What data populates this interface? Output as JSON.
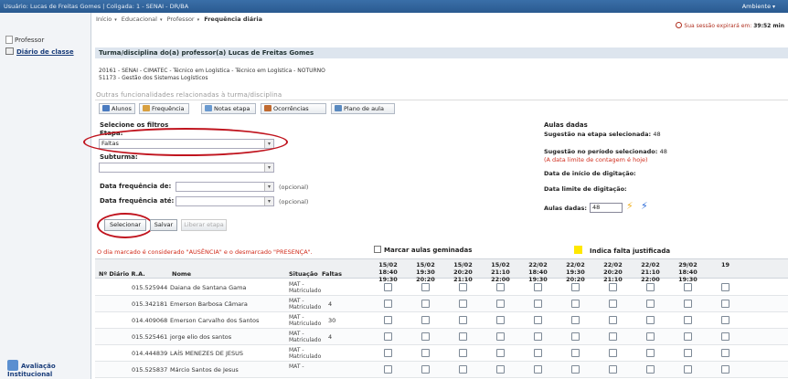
{
  "topbar": {
    "user": "Usuário: Lucas de Freitas Gomes  |  Coligada: 1 - SENAI - DR/BA",
    "ambiente": "Ambiente"
  },
  "breadcrumb": {
    "inicio": "Início",
    "educacional": "Educacional",
    "professor": "Professor",
    "current": "Frequência diária"
  },
  "session": {
    "text": "Sua sessão expirará em:",
    "time": "39:52 min"
  },
  "left_nav": {
    "professor": "Professor",
    "diario": "Diário de classe",
    "avaliacao": "Avaliação Institucional"
  },
  "panel": {
    "title": "Turma/disciplina do(a) professor(a) Lucas de Freitas Gomes",
    "turma": "20161 - SENAI - CIMATEC - Técnico em Logística - Técnico em Logística - NOTURNO",
    "disciplina": "51173 - Gestão dos Sistemas Logísticos",
    "outras": "Outras funcionalidades relacionadas à turma/disciplina"
  },
  "tabs": [
    "Alunos",
    "Frequência",
    "Notas etapa",
    "Ocorrências",
    "Plano de aula"
  ],
  "filters": {
    "title": "Selecione os filtros",
    "etapa_label": "Etapa:",
    "etapa_value": "Faltas",
    "subturma_label": "Subturma:",
    "subturma_value": "",
    "freq_de_label": "Data frequência de:",
    "freq_ate_label": "Data frequência até:",
    "opcional": "(opcional)"
  },
  "buttons": {
    "selecionar": "Selecionar",
    "salvar": "Salvar",
    "liberar": "Liberar etapa"
  },
  "aulas": {
    "title": "Aulas dadas",
    "sug_etapa_label": "Sugestão na etapa selecionada:",
    "sug_etapa_value": "48",
    "sug_periodo_label": "Sugestão no período selecionado:",
    "sug_periodo_value": "48",
    "limite_note": "(A data limite de contagem é hoje)",
    "inicio_label": "Data de início de digitação:",
    "limite_label": "Data limite de digitação:",
    "aulas_label": "Aulas dadas:",
    "aulas_value": "48"
  },
  "legend": {
    "note": "O dia marcado é considerado \"AUSÊNCIA\" e o desmarcado \"PRESENÇA\".",
    "geminadas": "Marcar aulas geminadas",
    "justificada": "Indica falta justificada",
    "justificada_color": "#ffe800"
  },
  "table": {
    "headers": {
      "diario": "Nº Diário R.A.",
      "nome": "Nome",
      "situacao": "Situação",
      "faltas": "Faltas"
    },
    "dates": [
      {
        "d": "15/02",
        "t": "18:40 19:30"
      },
      {
        "d": "15/02",
        "t": "19:30 20:20"
      },
      {
        "d": "15/02",
        "t": "20:20 21:10"
      },
      {
        "d": "15/02",
        "t": "21:10 22:00"
      },
      {
        "d": "22/02",
        "t": "18:40 19:30"
      },
      {
        "d": "22/02",
        "t": "19:30 20:20"
      },
      {
        "d": "22/02",
        "t": "20:20 21:10"
      },
      {
        "d": "22/02",
        "t": "21:10 22:00"
      },
      {
        "d": "29/02",
        "t": "18:40 19:30"
      },
      {
        "d": "",
        "t": "19"
      }
    ],
    "rows": [
      {
        "ra": "015.525944",
        "nome": "Daiana de Santana Gama",
        "sit1": "MAT -",
        "sit2": "Matriculado",
        "faltas": ""
      },
      {
        "ra": "015.342181",
        "nome": "Emerson Barbosa Câmara",
        "sit1": "MAT -",
        "sit2": "Matriculado",
        "faltas": "4"
      },
      {
        "ra": "014.409068",
        "nome": "Emerson Carvalho dos Santos",
        "sit1": "MAT -",
        "sit2": "Matriculado",
        "faltas": "30"
      },
      {
        "ra": "015.525461",
        "nome": "jorge elio dos santos",
        "sit1": "MAT -",
        "sit2": "Matriculado",
        "faltas": "4"
      },
      {
        "ra": "014.444839",
        "nome": "LAÍS MENEZES DE JESUS",
        "sit1": "MAT -",
        "sit2": "Matriculado",
        "faltas": ""
      },
      {
        "ra": "015.525837",
        "nome": "Márcio Santos de Jesus",
        "sit1": "MAT -",
        "sit2": "",
        "faltas": ""
      }
    ]
  }
}
